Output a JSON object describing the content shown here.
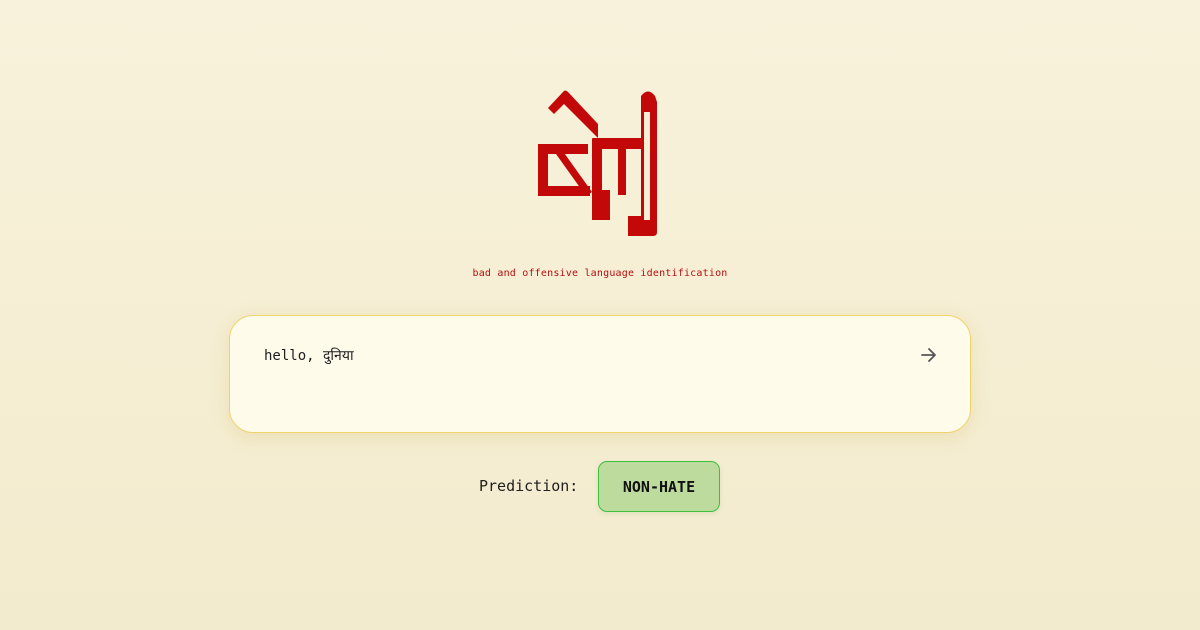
{
  "header": {
    "tagline": "bad and offensive language identification"
  },
  "input": {
    "value": "hello, दुनिया",
    "placeholder": ""
  },
  "prediction": {
    "label": "Prediction:",
    "result": "NON-HATE"
  },
  "icons": {
    "submit": "arrow-right-icon",
    "logo": "bolti-logo"
  },
  "colors": {
    "logo": "#c20808",
    "tagline": "#b30f0f",
    "card_border": "#efd36c",
    "badge_bg": "#bddb9d",
    "badge_border": "#3fbf3f"
  }
}
